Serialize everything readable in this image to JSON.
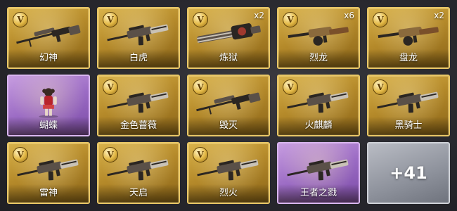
{
  "inventory": {
    "items": [
      {
        "name": "幻神",
        "count": "",
        "rarity": "gold",
        "badge": "V",
        "kind": "sniper"
      },
      {
        "name": "白虎",
        "count": "",
        "rarity": "gold",
        "badge": "V",
        "kind": "rifle"
      },
      {
        "name": "炼狱",
        "count": "x2",
        "rarity": "gold",
        "badge": "V",
        "kind": "gatling"
      },
      {
        "name": "烈龙",
        "count": "x6",
        "rarity": "gold",
        "badge": "V",
        "kind": "smg"
      },
      {
        "name": "盘龙",
        "count": "x2",
        "rarity": "gold",
        "badge": "V",
        "kind": "smg"
      },
      {
        "name": "蝴蝶",
        "count": "",
        "rarity": "purple",
        "badge": "",
        "kind": "character"
      },
      {
        "name": "金色蔷薇",
        "count": "",
        "rarity": "gold",
        "badge": "V",
        "kind": "rifle"
      },
      {
        "name": "毁灭",
        "count": "",
        "rarity": "gold",
        "badge": "V",
        "kind": "sniper"
      },
      {
        "name": "火麒麟",
        "count": "",
        "rarity": "gold",
        "badge": "V",
        "kind": "rifle"
      },
      {
        "name": "黑骑士",
        "count": "",
        "rarity": "gold",
        "badge": "V",
        "kind": "rifle"
      },
      {
        "name": "雷神",
        "count": "",
        "rarity": "gold",
        "badge": "V",
        "kind": "rifle"
      },
      {
        "name": "天启",
        "count": "",
        "rarity": "gold",
        "badge": "V",
        "kind": "rifle"
      },
      {
        "name": "烈火",
        "count": "",
        "rarity": "gold",
        "badge": "V",
        "kind": "rifle"
      },
      {
        "name": "王者之戮",
        "count": "",
        "rarity": "purple",
        "badge": "",
        "kind": "rifle"
      }
    ],
    "more": {
      "label": "+41"
    },
    "colors": {
      "gold": "#c99b34",
      "purple": "#9b6bc4",
      "more": "#8d919b"
    }
  }
}
